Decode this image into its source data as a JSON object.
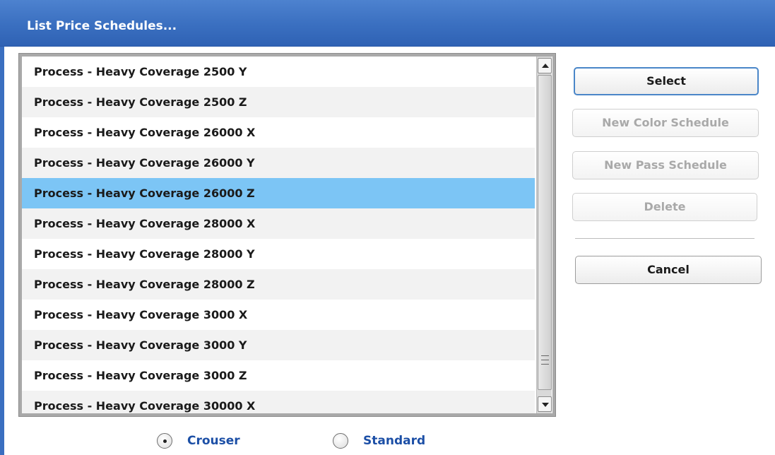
{
  "dialog": {
    "title": "List Price Schedules..."
  },
  "list": {
    "items": [
      "Process - Heavy Coverage 2500 Y",
      "Process - Heavy Coverage 2500 Z",
      "Process - Heavy Coverage 26000 X",
      "Process - Heavy Coverage 26000 Y",
      "Process - Heavy Coverage 26000 Z",
      "Process - Heavy Coverage 28000 X",
      "Process - Heavy Coverage 28000 Y",
      "Process - Heavy Coverage 28000 Z",
      "Process - Heavy Coverage 3000 X",
      "Process - Heavy Coverage 3000 Y",
      "Process - Heavy Coverage 3000 Z",
      "Process - Heavy Coverage 30000 X"
    ],
    "selected": "Process - Heavy Coverage 26000 Z"
  },
  "buttons": {
    "select": "Select",
    "new_color_schedule": "New Color Schedule",
    "new_pass_schedule": "New Pass Schedule",
    "delete": "Delete",
    "cancel": "Cancel"
  },
  "radio": {
    "options": [
      "Crouser",
      "Standard"
    ],
    "selected": "Crouser"
  },
  "colors": {
    "title_bar": "#3a6fc0",
    "selected_row": "#7cc5f5",
    "radio_label": "#1c4fa6"
  }
}
